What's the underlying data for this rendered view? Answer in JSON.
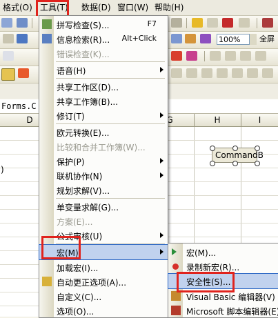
{
  "menubar": {
    "items": [
      "格式(O)",
      "工具(T)",
      "数据(D)",
      "窗口(W)",
      "帮助(H)"
    ]
  },
  "toolbar": {
    "zoom": "100%",
    "font_name": "全屏"
  },
  "sheet": {
    "name_box": "Forms.C",
    "columns": [
      "D",
      "G",
      "H",
      "I"
    ],
    "command_button": "CommandB",
    "partial_row_text": ")"
  },
  "menu": {
    "items": [
      {
        "label": "拼写检查(S)...",
        "shortcut": "F7"
      },
      {
        "label": "信息检索(R)...",
        "shortcut": "Alt+Click"
      },
      {
        "label": "错误检查(K)..."
      },
      {
        "label": "语音(H)"
      },
      {
        "label": "共享工作区(D)..."
      },
      {
        "label": "共享工作簿(B)..."
      },
      {
        "label": "修订(T)"
      },
      {
        "label": "欧元转换(E)..."
      },
      {
        "label": "比较和合并工作簿(W)..."
      },
      {
        "label": "保护(P)"
      },
      {
        "label": "联机协作(N)"
      },
      {
        "label": "规划求解(V)..."
      },
      {
        "label": "单变量求解(G)..."
      },
      {
        "label": "方案(E)..."
      },
      {
        "label": "公式审核(U)"
      },
      {
        "label": "宏(M)"
      },
      {
        "label": "加载宏(I)..."
      },
      {
        "label": "自动更正选项(A)..."
      },
      {
        "label": "自定义(C)..."
      },
      {
        "label": "选项(O)..."
      }
    ]
  },
  "submenu": {
    "items": [
      {
        "label": "宏(M)..."
      },
      {
        "label": "录制新宏(R)..."
      },
      {
        "label": "安全性(S)..."
      },
      {
        "label": "Visual Basic 编辑器(V)"
      },
      {
        "label": "Microsoft 脚本编辑器(E)"
      }
    ]
  },
  "colors": {
    "highlight": "#c1d2ee",
    "annotation_red": "#e0231d",
    "menu_bg": "#fcfcfa"
  }
}
